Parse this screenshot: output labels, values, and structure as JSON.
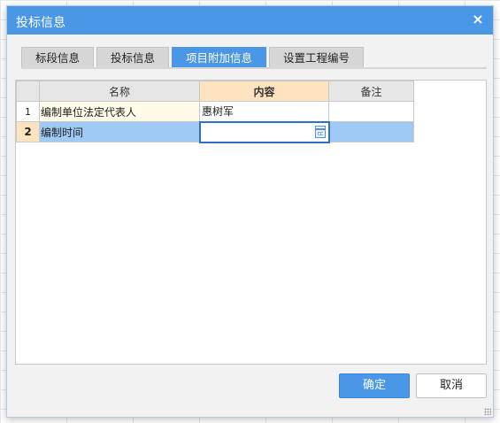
{
  "dialog": {
    "title": "投标信息",
    "close_label": "×"
  },
  "tabs": [
    {
      "label": "标段信息",
      "active": false
    },
    {
      "label": "投标信息",
      "active": false
    },
    {
      "label": "项目附加信息",
      "active": true
    },
    {
      "label": "设置工程编号",
      "active": false
    }
  ],
  "grid": {
    "columns": [
      "",
      "名称",
      "内容",
      "备注"
    ],
    "rows": [
      {
        "num": "1",
        "name": "编制单位法定代表人",
        "content": "惠树军",
        "note": ""
      },
      {
        "num": "2",
        "name": "编制时间",
        "content": "",
        "note": ""
      }
    ]
  },
  "buttons": {
    "ok": "确定",
    "cancel": "取消"
  }
}
